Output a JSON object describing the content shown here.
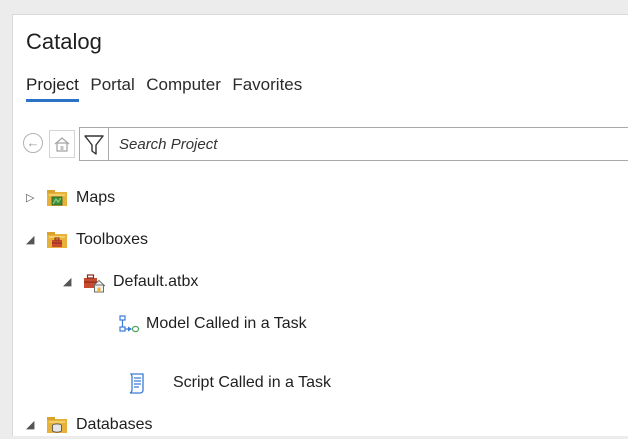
{
  "catalog": {
    "title": "Catalog",
    "tabs": [
      {
        "label": "Project"
      },
      {
        "label": "Portal"
      },
      {
        "label": "Computer"
      },
      {
        "label": "Favorites"
      }
    ],
    "search": {
      "placeholder": "Search Project",
      "value": ""
    },
    "tree": {
      "maps": {
        "label": "Maps",
        "expander": "▷",
        "icon": "folder-map-icon"
      },
      "toolboxes": {
        "label": "Toolboxes",
        "expander": "◢",
        "icon": "folder-toolbox-icon"
      },
      "default_atbx": {
        "label": "Default.atbx",
        "expander": "◢",
        "icon": "toolbox-home-icon"
      },
      "model_task": {
        "label": "Model Called in a Task",
        "icon": "model-icon"
      },
      "script_task": {
        "label": "Script Called in a Task",
        "icon": "script-icon"
      },
      "databases": {
        "label": "Databases",
        "expander": "◢",
        "icon": "folder-database-icon"
      }
    }
  },
  "colors": {
    "tab_underline": "#2b73c6",
    "folder": "#e8b23a",
    "toolbox_red": "#c84a2f",
    "model_blue": "#3a7bd5",
    "model_green": "#4aa35a"
  }
}
